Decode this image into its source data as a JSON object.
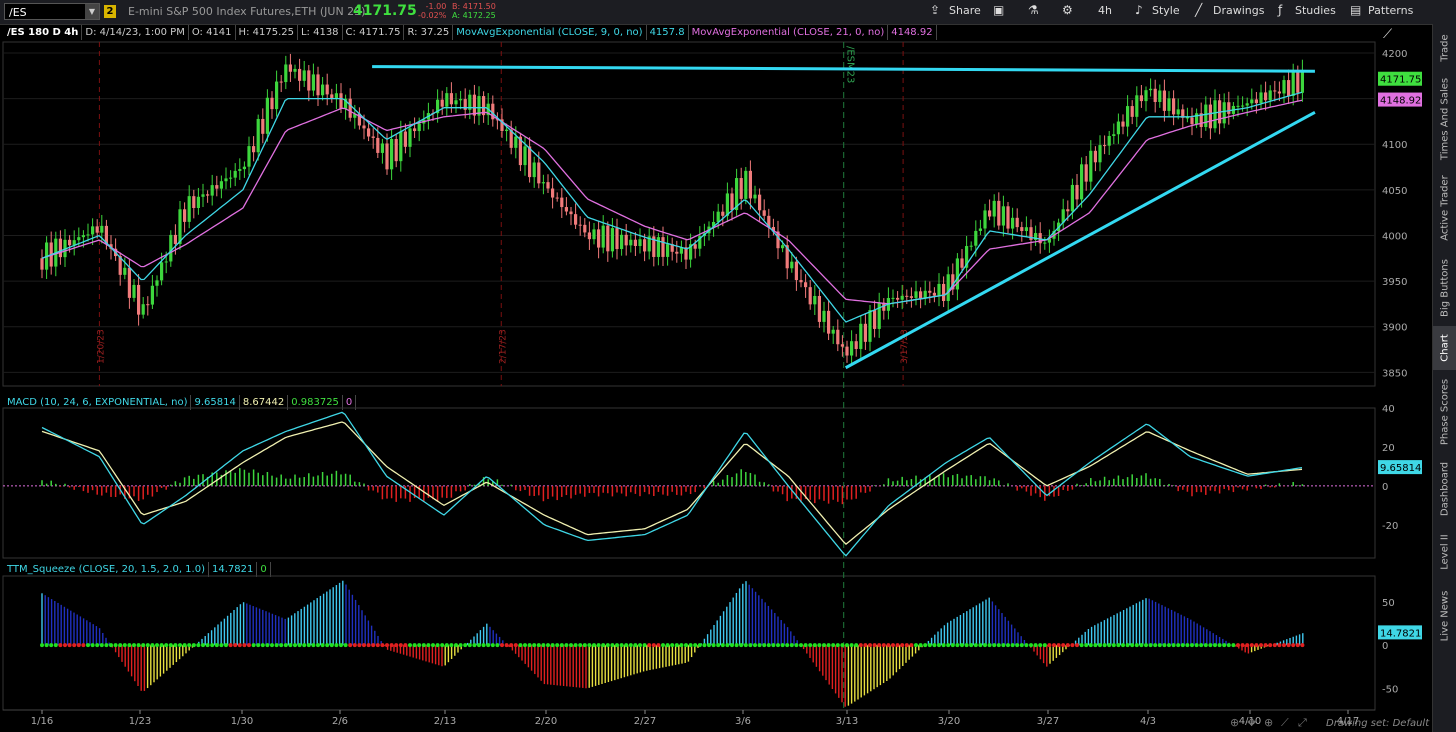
{
  "topbar": {
    "symbol": "/ES",
    "link_badge": "2",
    "description": "E-mini S&P 500 Index Futures,ETH (JUN 23)",
    "last": "4171.75",
    "change": "-1.00",
    "change_pct": "-0.02%",
    "bid": "B: 4171.50",
    "ask": "A: 4172.25",
    "share_label": "Share",
    "timeframe_label": "4h",
    "style_label": "Style",
    "drawings_label": "Drawings",
    "studies_label": "Studies",
    "patterns_label": "Patterns"
  },
  "sidebar": {
    "tabs": [
      "Trade",
      "Times And Sales",
      "Active Trader",
      "Big Buttons",
      "Chart",
      "Phase Scores",
      "Dashboard",
      "Level II",
      "Live News"
    ]
  },
  "price_header": {
    "study": "/ES 180 D 4h",
    "date": "D: 4/14/23, 1:00 PM",
    "open": "O: 4141",
    "high": "H: 4175.25",
    "low": "L: 4138",
    "close": "C: 4171.75",
    "range": "R: 37.25",
    "ema9_label": "MovAvgExponential (CLOSE, 9, 0, no)",
    "ema9_value": "4157.8",
    "ema21_label": "MovAvgExponential (CLOSE, 21, 0, no)",
    "ema21_value": "4148.92"
  },
  "macd_header": {
    "label": "MACD (10, 24, 6, EXPONENTIAL, no)",
    "value": "9.65814",
    "avg": "8.67442",
    "diff": "0.983725",
    "zero": "0"
  },
  "ttm_header": {
    "label": "TTM_Squeeze (CLOSE, 20, 1.5, 2.0, 1.0)",
    "value": "14.7821",
    "zero": "0"
  },
  "colors": {
    "up_candle": "#3dd63d",
    "down_candle": "#f07b7b",
    "ema9": "#3fd7e6",
    "ema21": "#e070e0",
    "trendline": "#33d9f2",
    "macd_line": "#3fd7e6",
    "macd_avg": "#f0f0b0",
    "squeeze_on": "#e02020",
    "squeeze_off": "#20e020"
  },
  "date_markers": [
    "1/20/23",
    "2/17/23",
    "3/17/23"
  ],
  "contract_marker": "/ESM23",
  "footer": {
    "drawing_set": "Drawing set: Default"
  },
  "chart_data": [
    {
      "type": "line",
      "name": "price",
      "x_ticks": [
        "1/16",
        "1/23",
        "1/30",
        "2/6",
        "2/13",
        "2/20",
        "2/27",
        "3/6",
        "3/13",
        "3/20",
        "3/27",
        "4/3",
        "4/10",
        "4/17"
      ],
      "y_ticks": [
        3850,
        3900,
        3950,
        4000,
        4050,
        4100,
        4150,
        4200
      ],
      "ylim": [
        3835,
        4212
      ],
      "x_dates": [
        "1/16",
        "1/20",
        "1/23",
        "1/26",
        "1/30",
        "2/2",
        "2/6",
        "2/9",
        "2/13",
        "2/16",
        "2/20",
        "2/23",
        "2/27",
        "3/2",
        "3/6",
        "3/9",
        "3/13",
        "3/16",
        "3/20",
        "3/23",
        "3/27",
        "3/30",
        "4/3",
        "4/6",
        "4/10",
        "4/14"
      ],
      "series": [
        {
          "values": [
            3975,
            4010,
            3915,
            4030,
            4075,
            4185,
            4145,
            4085,
            4150,
            4140,
            4055,
            4000,
            3990,
            3980,
            4060,
            3970,
            3870,
            3930,
            3940,
            4030,
            3990,
            4080,
            4160,
            4125,
            4145,
            4171.75
          ]
        },
        {
          "values": [
            3975,
            4000,
            3950,
            4000,
            4050,
            4150,
            4150,
            4105,
            4140,
            4140,
            4080,
            4020,
            3998,
            3985,
            4040,
            3985,
            3905,
            3925,
            3935,
            4005,
            3995,
            4045,
            4130,
            4130,
            4140,
            4157.8
          ]
        },
        {
          "values": [
            3975,
            3995,
            3965,
            3990,
            4030,
            4115,
            4140,
            4115,
            4130,
            4135,
            4095,
            4040,
            4010,
            3995,
            4025,
            3995,
            3930,
            3925,
            3935,
            3985,
            3995,
            4025,
            4105,
            4120,
            4135,
            4148.92
          ]
        }
      ],
      "annotations": [
        {
          "type": "resistance",
          "from": [
            "2/8",
            4185
          ],
          "to": [
            "4/14",
            4180
          ]
        },
        {
          "type": "support",
          "from": [
            "3/13",
            3855
          ],
          "to": [
            "4/14",
            4135
          ]
        }
      ],
      "last_labels": [
        "4171.75",
        "4148.92"
      ]
    },
    {
      "type": "line",
      "name": "MACD",
      "y_ticks": [
        -20,
        0,
        20,
        40
      ],
      "ylim": [
        -37,
        40
      ],
      "x_dates": [
        "1/16",
        "1/20",
        "1/23",
        "1/26",
        "1/30",
        "2/2",
        "2/6",
        "2/9",
        "2/13",
        "2/16",
        "2/20",
        "2/23",
        "2/27",
        "3/2",
        "3/6",
        "3/9",
        "3/13",
        "3/16",
        "3/20",
        "3/23",
        "3/27",
        "3/30",
        "4/3",
        "4/6",
        "4/10",
        "4/14"
      ],
      "series": [
        {
          "values": [
            30,
            15,
            -20,
            -5,
            18,
            28,
            38,
            5,
            -15,
            5,
            -20,
            -28,
            -25,
            -15,
            28,
            0,
            -36,
            -10,
            12,
            25,
            -5,
            12,
            32,
            15,
            5,
            9.66
          ]
        },
        {
          "values": [
            28,
            18,
            -15,
            -8,
            12,
            25,
            33,
            10,
            -10,
            2,
            -15,
            -25,
            -22,
            -12,
            22,
            5,
            -30,
            -12,
            8,
            22,
            0,
            10,
            28,
            18,
            6,
            8.67
          ]
        }
      ],
      "last_label": "9.65814"
    },
    {
      "type": "bar",
      "name": "TTM_Squeeze",
      "y_ticks": [
        -50,
        0,
        50
      ],
      "ylim": [
        -75,
        80
      ],
      "x_dates": [
        "1/16",
        "1/20",
        "1/23",
        "1/26",
        "1/30",
        "2/2",
        "2/6",
        "2/9",
        "2/13",
        "2/16",
        "2/20",
        "2/23",
        "2/27",
        "3/2",
        "3/6",
        "3/9",
        "3/13",
        "3/16",
        "3/20",
        "3/23",
        "3/27",
        "3/30",
        "4/3",
        "4/6",
        "4/10",
        "4/14"
      ],
      "values": [
        60,
        20,
        -55,
        -10,
        50,
        30,
        75,
        -5,
        -25,
        25,
        -45,
        -50,
        -30,
        -20,
        75,
        20,
        -72,
        -40,
        25,
        55,
        -25,
        20,
        55,
        30,
        -10,
        14.78
      ],
      "last_label": "14.7821"
    }
  ]
}
